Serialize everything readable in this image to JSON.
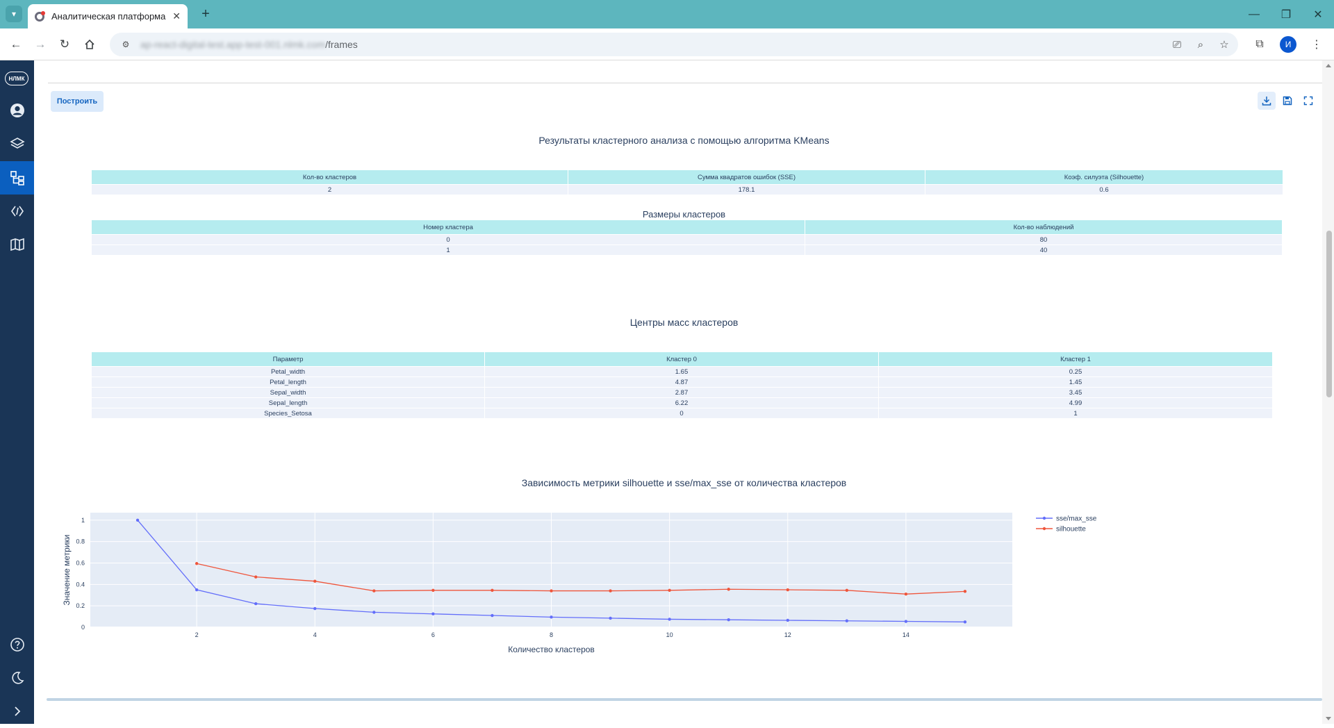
{
  "browser": {
    "tab_title": "Аналитическая платформа",
    "url_host": "ap-react-digital-test.app-test-001.nlmk.com",
    "url_path": "/frames",
    "profile_initial": "И"
  },
  "app": {
    "logo_text": "НЛМК",
    "sidebar_items": [
      "user-icon",
      "layers-icon",
      "frames-icon",
      "code-icon",
      "map-icon",
      "help-icon",
      "moon-icon",
      "chevron-right-icon"
    ],
    "active_item": "frames-icon",
    "accent": "#0b5fbf",
    "sidebar_bg": "#1a3556"
  },
  "toolbar": {
    "build_label": "Построить"
  },
  "summary": {
    "title": "Результаты кластерного анализа с помощью алгоритма KMeans",
    "headers": [
      "Кол-во кластеров",
      "Сумма квадратов ошибок (SSE)",
      "Коэф. силуэта (Silhouette)"
    ],
    "rows": [
      [
        "2",
        "178.1",
        "0.6"
      ]
    ]
  },
  "sizes": {
    "title": "Размеры кластеров",
    "headers": [
      "Номер кластера",
      "Кол-во наблюдений"
    ],
    "rows": [
      [
        "0",
        "80"
      ],
      [
        "1",
        "40"
      ]
    ]
  },
  "centers": {
    "title": "Центры масс кластеров",
    "headers": [
      "Параметр",
      "Кластер 0",
      "Кластер 1"
    ],
    "rows": [
      [
        "Petal_width",
        "1.65",
        "0.25"
      ],
      [
        "Petal_length",
        "4.87",
        "1.45"
      ],
      [
        "Sepal_width",
        "2.87",
        "3.45"
      ],
      [
        "Sepal_length",
        "6.22",
        "4.99"
      ],
      [
        "Species_Setosa",
        "0",
        "1"
      ]
    ]
  },
  "chart_data": {
    "type": "line",
    "title": "Зависимость метрики silhouette и sse/max_sse от количества кластеров",
    "xlabel": "Количество кластеров",
    "ylabel": "Значение метрики",
    "xlim": [
      0.2,
      15.8
    ],
    "ylim": [
      0,
      1.07
    ],
    "xticks": [
      2,
      4,
      6,
      8,
      10,
      12,
      14
    ],
    "yticks": [
      0,
      0.2,
      0.4,
      0.6,
      0.8,
      1
    ],
    "ytick_labels": [
      "0",
      "0.2",
      "0.4",
      "0.6",
      "0.8",
      "1"
    ],
    "grid": true,
    "legend_position": "top-right",
    "series": [
      {
        "name": "sse/max_sse",
        "color": "#636efa",
        "x": [
          1,
          2,
          3,
          4,
          5,
          6,
          7,
          8,
          9,
          10,
          11,
          12,
          13,
          14,
          15
        ],
        "y": [
          1.0,
          0.35,
          0.22,
          0.175,
          0.14,
          0.125,
          0.11,
          0.095,
          0.085,
          0.075,
          0.07,
          0.065,
          0.06,
          0.055,
          0.05
        ]
      },
      {
        "name": "silhouette",
        "color": "#ef553b",
        "x": [
          2,
          3,
          4,
          5,
          6,
          7,
          8,
          9,
          10,
          11,
          12,
          13,
          14,
          15
        ],
        "y": [
          0.595,
          0.47,
          0.43,
          0.34,
          0.345,
          0.345,
          0.34,
          0.34,
          0.345,
          0.355,
          0.35,
          0.345,
          0.31,
          0.335
        ]
      }
    ]
  }
}
